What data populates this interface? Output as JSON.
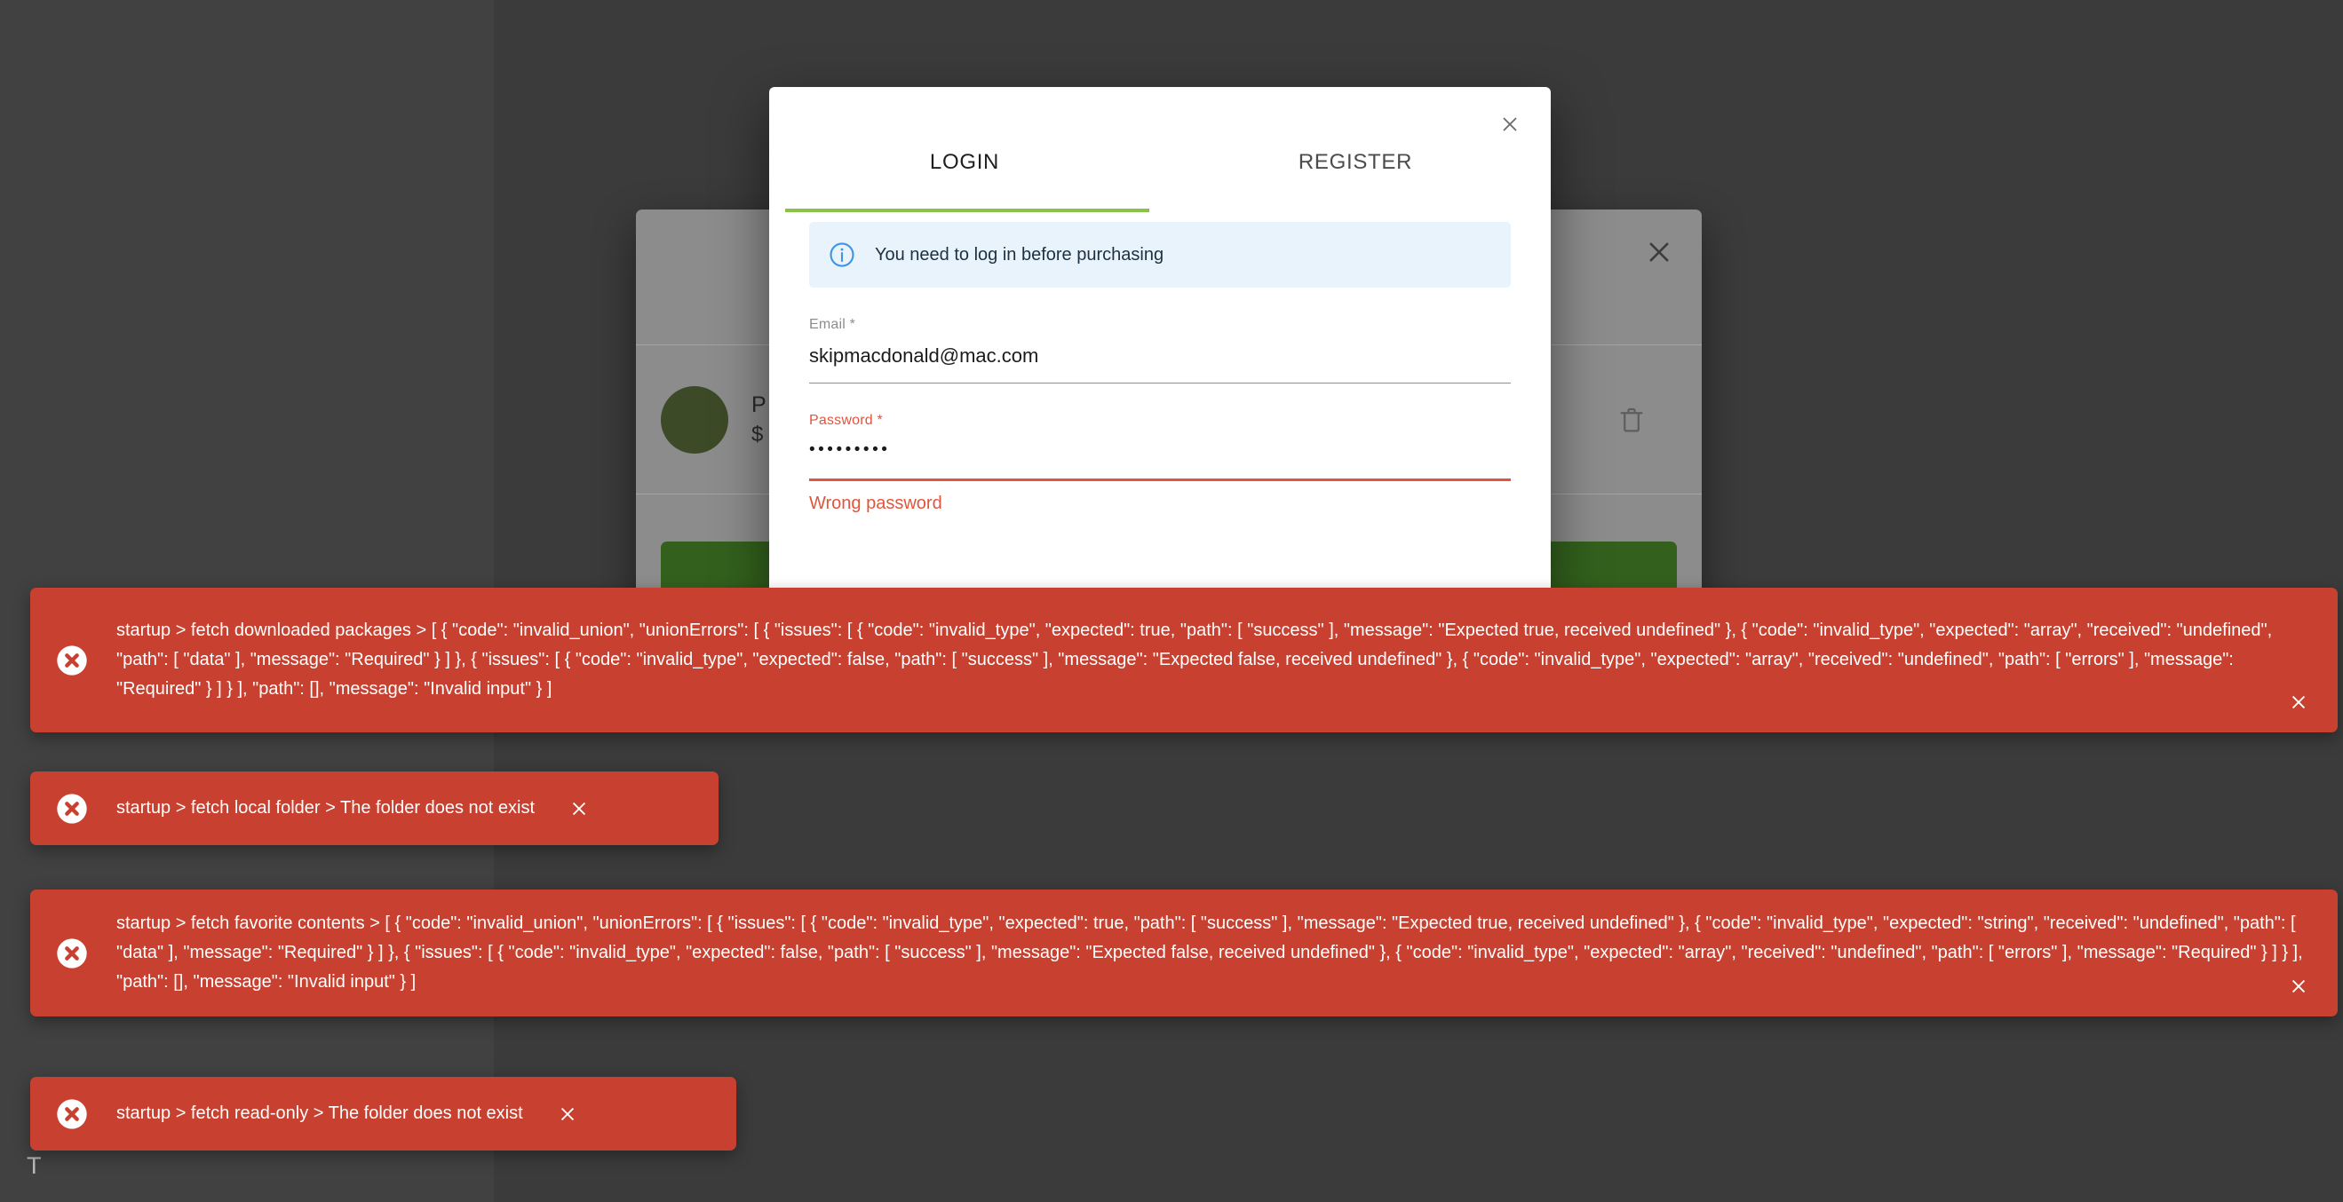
{
  "colors": {
    "accent_green": "#8bc34a",
    "cta_green": "#33611d",
    "error_red": "#c8402f",
    "field_error": "#e2553c",
    "info_banner_bg": "#e9f3fc",
    "backdrop": "#3d3d3d"
  },
  "background": {
    "stray_letter": "T",
    "product_dialog": {
      "product_name_partial": "P",
      "price_partial": "$",
      "close_icon": "close-icon",
      "delete_icon": "trash-icon"
    }
  },
  "modal": {
    "close_icon": "close-icon",
    "tabs": [
      {
        "label": "LOGIN",
        "active": true
      },
      {
        "label": "REGISTER",
        "active": false
      }
    ],
    "info": {
      "icon": "info-circle-icon",
      "message": "You need to log in before purchasing"
    },
    "email_field": {
      "label": "Email *",
      "value": "skipmacdonald@mac.com",
      "placeholder": "Email"
    },
    "password_field": {
      "label": "Password *",
      "value": "•••••••••",
      "placeholder": "Password",
      "error": "Wrong password"
    }
  },
  "toasts": [
    {
      "icon": "error-circle-icon",
      "close_icon": "close-icon",
      "message": "startup > fetch downloaded packages > [ { \"code\": \"invalid_union\", \"unionErrors\": [ { \"issues\": [ { \"code\": \"invalid_type\", \"expected\": true, \"path\": [ \"success\" ], \"message\": \"Expected true, received undefined\" }, { \"code\": \"invalid_type\", \"expected\": \"array\", \"received\": \"undefined\", \"path\": [ \"data\" ], \"message\": \"Required\" } ] }, { \"issues\": [ { \"code\": \"invalid_type\", \"expected\": false, \"path\": [ \"success\" ], \"message\": \"Expected false, received undefined\" }, { \"code\": \"invalid_type\", \"expected\": \"array\", \"received\": \"undefined\", \"path\": [ \"errors\" ], \"message\": \"Required\" } ] } ], \"path\": [], \"message\": \"Invalid input\" } ]"
    },
    {
      "icon": "error-circle-icon",
      "close_icon": "close-icon",
      "message": "startup > fetch local folder > The folder does not exist"
    },
    {
      "icon": "error-circle-icon",
      "close_icon": "close-icon",
      "message": "startup > fetch favorite contents > [ { \"code\": \"invalid_union\", \"unionErrors\": [ { \"issues\": [ { \"code\": \"invalid_type\", \"expected\": true, \"path\": [ \"success\" ], \"message\": \"Expected true, received undefined\" }, { \"code\": \"invalid_type\", \"expected\": \"string\", \"received\": \"undefined\", \"path\": [ \"data\" ], \"message\": \"Required\" } ] }, { \"issues\": [ { \"code\": \"invalid_type\", \"expected\": false, \"path\": [ \"success\" ], \"message\": \"Expected false, received undefined\" }, { \"code\": \"invalid_type\", \"expected\": \"array\", \"received\": \"undefined\", \"path\": [ \"errors\" ], \"message\": \"Required\" } ] } ], \"path\": [], \"message\": \"Invalid input\" } ]"
    },
    {
      "icon": "error-circle-icon",
      "close_icon": "close-icon",
      "message": "startup > fetch read-only > The folder does not exist"
    }
  ]
}
